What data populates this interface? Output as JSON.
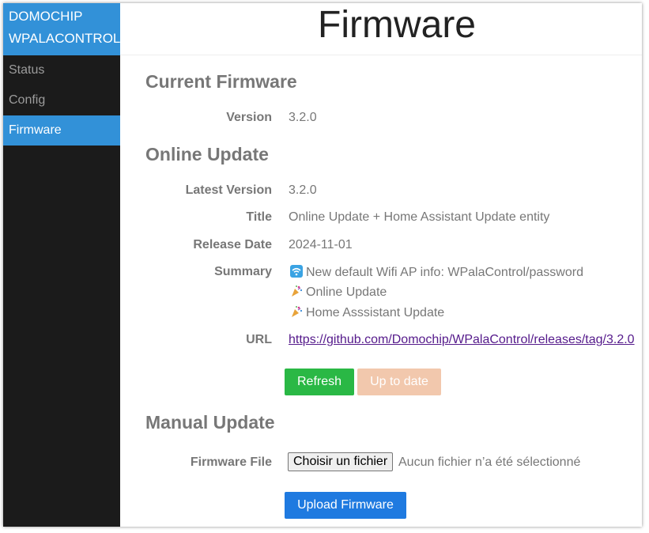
{
  "sidebar": {
    "brand_line1": "DOMOCHIP",
    "brand_line2": "WPALACONTROL",
    "items": [
      {
        "label": "Status",
        "active": false
      },
      {
        "label": "Config",
        "active": false
      },
      {
        "label": "Firmware",
        "active": true
      }
    ],
    "accent_color": "#3291d8"
  },
  "header": {
    "title": "Firmware"
  },
  "current": {
    "section_title": "Current Firmware",
    "version_label": "Version",
    "version_value": "3.2.0"
  },
  "online": {
    "section_title": "Online Update",
    "latest_label": "Latest Version",
    "latest_value": "3.2.0",
    "title_label": "Title",
    "title_value": "Online Update + Home Assistant Update entity",
    "date_label": "Release Date",
    "date_value": "2024-11-01",
    "summary_label": "Summary",
    "summary": [
      {
        "icon": "wifi-icon",
        "text": "New default Wifi AP info: WPalaControl/password"
      },
      {
        "icon": "party-popper-icon",
        "text": "Online Update"
      },
      {
        "icon": "party-popper-icon",
        "text": "Home Asssistant Update"
      }
    ],
    "url_label": "URL",
    "url_value": "https://github.com/Domochip/WPalaControl/releases/tag/3.2.0",
    "refresh_label": "Refresh",
    "refresh_color": "#2ab845",
    "uptodate_label": "Up to date",
    "uptodate_color": "#f2c8ad"
  },
  "manual": {
    "section_title": "Manual Update",
    "file_label": "Firmware File",
    "choose_label": "Choisir un fichier",
    "no_file_text": "Aucun fichier n’a été sélectionné",
    "upload_label": "Upload Firmware",
    "upload_color": "#1f7ae0"
  }
}
